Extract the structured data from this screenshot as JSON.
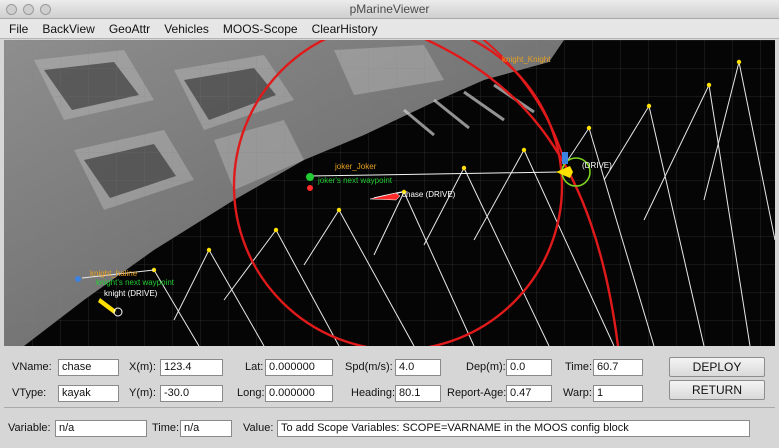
{
  "window": {
    "title": "pMarineViewer"
  },
  "menu": [
    "File",
    "BackView",
    "GeoAttr",
    "Vehicles",
    "MOOS-Scope",
    "ClearHistory"
  ],
  "map": {
    "vehicles": [
      {
        "name": "chase",
        "label": "chase (DRIVE)",
        "color": "#ff2a2a"
      },
      {
        "name": "joker",
        "label": "joker_Joker",
        "waypoint_label": "joker's next waypoint"
      },
      {
        "name": "knight",
        "label": "knight (DRIVE)",
        "title_label": "knight_haline",
        "waypoint_label": "knight's next waypoint"
      },
      {
        "name": "far",
        "label": "(DRIVE)",
        "title_label": "knight_Knight"
      }
    ],
    "colors": {
      "track": "#e01a1a",
      "marker": "#ffe000",
      "label_green": "#22cc33",
      "label_orange": "#e8a020",
      "label_white": "#ffffff"
    }
  },
  "fields": {
    "vname": {
      "label": "VName:",
      "value": "chase"
    },
    "vtype": {
      "label": "VType:",
      "value": "kayak"
    },
    "xm": {
      "label": "X(m):",
      "value": "123.4"
    },
    "ym": {
      "label": "Y(m):",
      "value": "-30.0"
    },
    "lat": {
      "label": "Lat:",
      "value": "0.000000"
    },
    "long": {
      "label": "Long:",
      "value": "0.000000"
    },
    "spd": {
      "label": "Spd(m/s):",
      "value": "4.0"
    },
    "heading": {
      "label": "Heading:",
      "value": "80.1"
    },
    "dep": {
      "label": "Dep(m):",
      "value": "0.0"
    },
    "report_age": {
      "label": "Report-Age:",
      "value": "0.47"
    },
    "time": {
      "label": "Time:",
      "value": "60.7"
    },
    "warp": {
      "label": "Warp:",
      "value": "1"
    }
  },
  "buttons": {
    "deploy": "DEPLOY",
    "return": "RETURN"
  },
  "scope": {
    "variable": {
      "label": "Variable:",
      "value": "n/a"
    },
    "time": {
      "label": "Time:",
      "value": "n/a"
    },
    "value": {
      "label": "Value:",
      "value": "To add Scope Variables: SCOPE=VARNAME in the MOOS config block"
    }
  }
}
